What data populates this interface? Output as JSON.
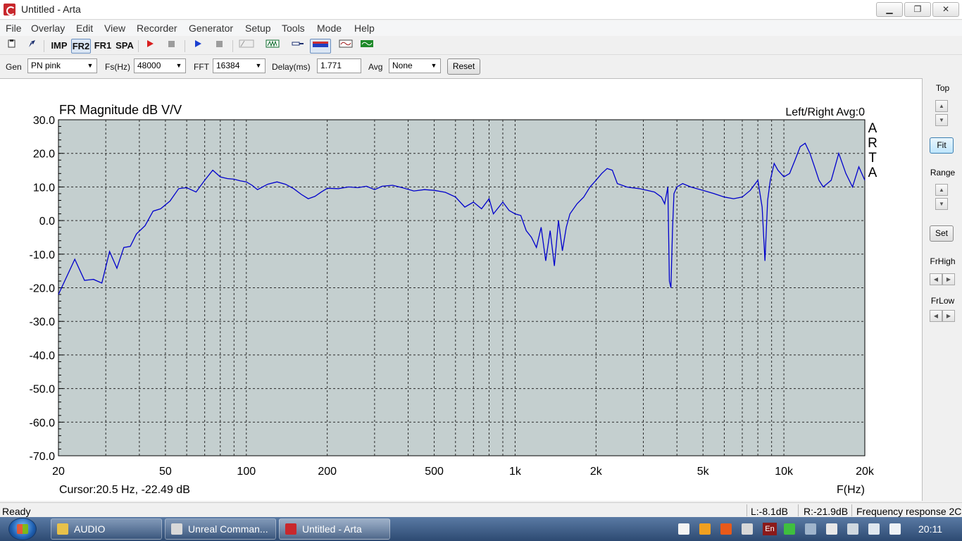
{
  "window": {
    "title": "Untitled - Arta",
    "minimize": "▁",
    "maximize": "❐",
    "close": "✕"
  },
  "menu": [
    "File",
    "Overlay",
    "Edit",
    "View",
    "Recorder",
    "Generator",
    "Setup",
    "Tools",
    "Mode",
    "Help"
  ],
  "toolbar": {
    "imp": "IMP",
    "fr2": "FR2",
    "fr1": "FR1",
    "spa": "SPA"
  },
  "params": {
    "gen_label": "Gen",
    "gen_value": "PN pink",
    "fs_label": "Fs(Hz)",
    "fs_value": "48000",
    "fft_label": "FFT",
    "fft_value": "16384",
    "delay_label": "Delay(ms)",
    "delay_value": "1.771",
    "avg_label": "Avg",
    "avg_value": "None",
    "reset_label": "Reset"
  },
  "right_panel": {
    "top_label": "Top",
    "fit_label": "Fit",
    "range_label": "Range",
    "set_label": "Set",
    "frhigh_label": "FrHigh",
    "frlow_label": "FrLow"
  },
  "plot": {
    "cursor_text": "Cursor:20.5 Hz, -22.49 dB",
    "brand": [
      "A",
      "R",
      "T",
      "A"
    ]
  },
  "status": {
    "ready": "Ready",
    "left_level": "L:-8.1dB",
    "right_level": "R:-21.9dB",
    "mode": "Frequency response 2C"
  },
  "taskbar": {
    "tasks": [
      "AUDIO",
      "Unreal Comman...",
      "Untitled - Arta"
    ],
    "lang": "En",
    "clock": "20:11"
  },
  "colors": {
    "plot_bg": "#c4cfcf",
    "trace": "#0000cc",
    "grid": "#2a2a2a"
  },
  "chart_data": {
    "type": "line",
    "title": "FR Magnitude dB V/V",
    "subtitle": "Left/Right  Avg:0",
    "xlabel": "F(Hz)",
    "ylabel": "",
    "x_scale": "log",
    "xlim": [
      20,
      20000
    ],
    "ylim": [
      -70,
      30
    ],
    "y_ticks": [
      30,
      20,
      10,
      0,
      -10,
      -20,
      -30,
      -40,
      -50,
      -60,
      -70
    ],
    "y_tick_labels": [
      "30.0",
      "20.0",
      "10.0",
      "0.0",
      "-10.0",
      "-20.0",
      "-30.0",
      "-40.0",
      "-50.0",
      "-60.0",
      "-70.0"
    ],
    "x_tick_labels": [
      {
        "f": 20,
        "label": "20"
      },
      {
        "f": 50,
        "label": "50"
      },
      {
        "f": 100,
        "label": "100"
      },
      {
        "f": 200,
        "label": "200"
      },
      {
        "f": 500,
        "label": "500"
      },
      {
        "f": 1000,
        "label": "1k"
      },
      {
        "f": 2000,
        "label": "2k"
      },
      {
        "f": 5000,
        "label": "5k"
      },
      {
        "f": 10000,
        "label": "10k"
      },
      {
        "f": 20000,
        "label": "20k"
      }
    ],
    "grid": true,
    "series": [
      {
        "x": [
          20,
          23,
          25,
          27,
          29,
          31,
          33,
          35,
          37,
          39,
          42,
          45,
          48,
          52,
          56,
          60,
          65,
          70,
          75,
          80,
          85,
          90,
          95,
          100,
          105,
          110,
          120,
          130,
          140,
          150,
          160,
          170,
          180,
          190,
          200,
          220,
          240,
          260,
          280,
          300,
          320,
          350,
          380,
          420,
          460,
          500,
          550,
          600,
          650,
          700,
          750,
          800,
          830,
          860,
          900,
          950,
          1000,
          1050,
          1100,
          1150,
          1200,
          1250,
          1300,
          1350,
          1400,
          1450,
          1500,
          1550,
          1600,
          1700,
          1800,
          1900,
          2000,
          2100,
          2200,
          2300,
          2400,
          2500,
          2600,
          2700,
          2900,
          3100,
          3300,
          3500,
          3600,
          3700,
          3750,
          3800,
          3850,
          3900,
          4000,
          4200,
          4500,
          5000,
          5500,
          6000,
          6500,
          7000,
          7500,
          8000,
          8300,
          8500,
          8700,
          8900,
          9200,
          9500,
          10000,
          10500,
          11000,
          11500,
          12000,
          12500,
          13000,
          13500,
          14000,
          15000,
          16000,
          17000,
          18000,
          19000,
          20000
        ],
        "y": [
          -22,
          -11.5,
          -17.8,
          -17.5,
          -18.6,
          -9.2,
          -14.2,
          -8,
          -7.7,
          -4,
          -1.5,
          2.8,
          3.5,
          5.8,
          9.5,
          9.8,
          8.5,
          12,
          15,
          13,
          12.5,
          12.3,
          11.8,
          11.5,
          10.5,
          9.2,
          10.8,
          11.5,
          10.8,
          9.5,
          7.8,
          6.5,
          7.2,
          8.5,
          9.6,
          9.5,
          10,
          9.8,
          10.2,
          9.2,
          10.2,
          10.5,
          9.8,
          8.8,
          9.2,
          9,
          8.4,
          7,
          4,
          5.5,
          3.5,
          6.5,
          2,
          3.5,
          5.5,
          3,
          2,
          1.5,
          -3,
          -5,
          -8,
          -2,
          -12,
          -3,
          -13.5,
          0,
          -9,
          -2,
          2,
          5,
          7,
          10,
          12,
          14,
          15.5,
          15,
          11,
          10.5,
          10,
          9.8,
          9.5,
          9,
          8.5,
          7,
          5,
          10,
          -18,
          -20,
          -3,
          8,
          10,
          11,
          10,
          9,
          8,
          7,
          6.5,
          7,
          9,
          12,
          4,
          -12,
          6,
          12,
          17,
          15,
          13,
          14,
          18,
          22,
          23,
          20,
          16,
          12,
          10,
          12,
          20,
          14,
          10,
          16,
          12
        ]
      }
    ]
  }
}
